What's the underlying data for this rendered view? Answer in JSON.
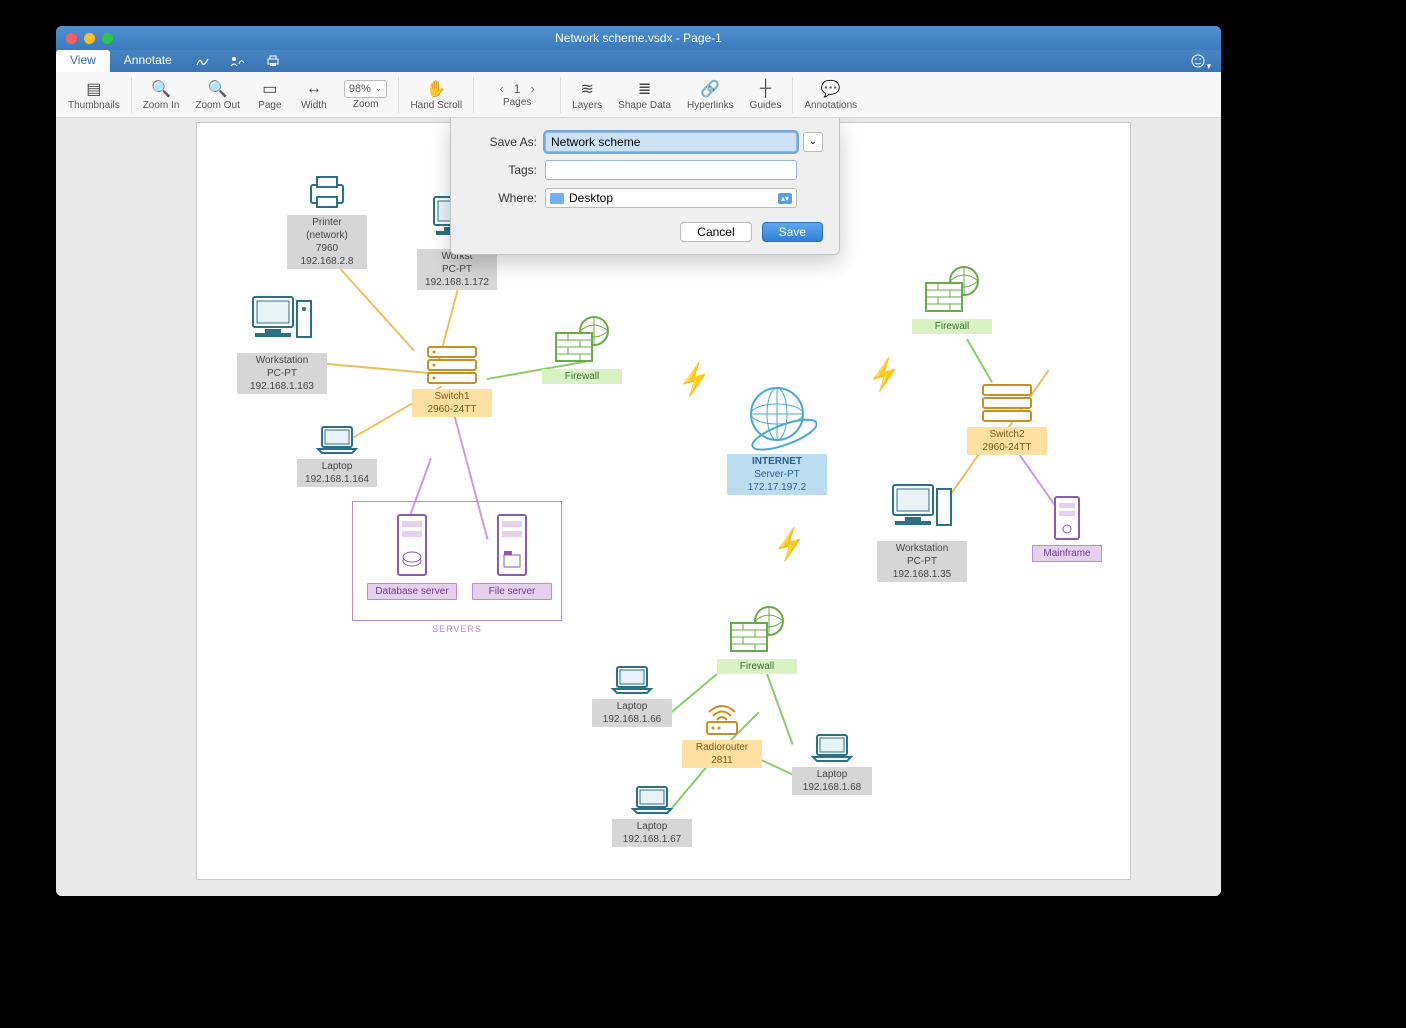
{
  "window": {
    "title": "Network scheme.vsdx - Page-1"
  },
  "menubar": {
    "tabs": [
      {
        "label": "View",
        "active": true
      },
      {
        "label": "Annotate",
        "active": false
      }
    ]
  },
  "toolbar": {
    "thumbnails": "Thumbnails",
    "zoom_in": "Zoom In",
    "zoom_out": "Zoom Out",
    "page": "Page",
    "width": "Width",
    "zoom_value": "98%",
    "zoom_label": "Zoom",
    "hand_scroll": "Hand Scroll",
    "pages_num": "1",
    "pages_label": "Pages",
    "layers": "Layers",
    "shape_data": "Shape Data",
    "hyperlinks": "Hyperlinks",
    "guides": "Guides",
    "annotations": "Annotations"
  },
  "dialog": {
    "save_as_label": "Save As:",
    "save_as_value": "Network scheme",
    "tags_label": "Tags:",
    "tags_value": "",
    "where_label": "Where:",
    "where_value": "Desktop",
    "cancel": "Cancel",
    "save": "Save"
  },
  "diagram": {
    "servers_caption": "SERVERS",
    "nodes": {
      "printer": {
        "title": "Printer",
        "sub1": "(network)",
        "sub2": "7960",
        "ip": "192.168.2.8"
      },
      "ws_top": {
        "title": "Workst",
        "sub1": "PC-PT",
        "ip": "192.168.1.172"
      },
      "ws_left": {
        "title": "Workstation",
        "sub1": "PC-PT",
        "ip": "192.168.1.163"
      },
      "switch1": {
        "title": "Switch1",
        "sub1": "2960-24TT"
      },
      "laptop1": {
        "title": "Laptop",
        "ip": "192.168.1.164"
      },
      "firewall_l": {
        "title": "Firewall"
      },
      "dbserver": {
        "title": "Database server"
      },
      "fileserver": {
        "title": "File server"
      },
      "internet": {
        "title": "INTERNET",
        "sub1": "Server-PT",
        "ip": "172.17.197.2"
      },
      "firewall_r": {
        "title": "Firewall"
      },
      "switch2": {
        "title": "Switch2",
        "sub1": "2960-24TT"
      },
      "ws_right": {
        "title": "Workstation",
        "sub1": "PC-PT",
        "ip": "192.168.1.35"
      },
      "mainframe": {
        "title": "Mainframe"
      },
      "firewall_b": {
        "title": "Firewall"
      },
      "laptop_b1": {
        "title": "Laptop",
        "ip": "192.168.1.66"
      },
      "radiorouter": {
        "title": "Radiorouter",
        "sub1": "2811"
      },
      "laptop_b2": {
        "title": "Laptop",
        "ip": "192.168.1.68"
      },
      "laptop_b3": {
        "title": "Laptop",
        "ip": "192.168.1.67"
      }
    }
  }
}
